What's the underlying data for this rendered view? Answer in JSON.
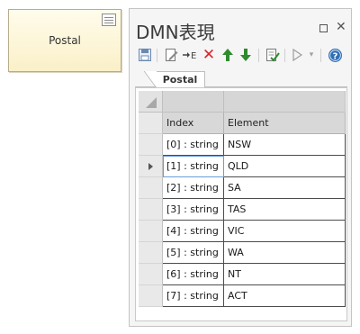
{
  "diagram": {
    "element_label": "Postal"
  },
  "window": {
    "title": "DMN表現",
    "maximize_icon": "maximize-icon",
    "close_icon": "close-icon"
  },
  "toolbar": {
    "icons": [
      "save-icon",
      "edit-icon",
      "insert-icon",
      "delete-icon",
      "move-up-icon",
      "move-down-icon",
      "validate-icon",
      "run-icon",
      "dropdown-icon",
      "help-icon"
    ],
    "colors": {
      "delete": "#d9262c",
      "arrows": "#2e8b2e",
      "help": "#2d6fb7"
    }
  },
  "tabs": [
    {
      "label": "Postal"
    }
  ],
  "table": {
    "columns": [
      "Index",
      "Element"
    ],
    "rows": [
      {
        "index": "[0] : string",
        "element": "NSW"
      },
      {
        "index": "[1] : string",
        "element": "QLD"
      },
      {
        "index": "[2] : string",
        "element": "SA"
      },
      {
        "index": "[3] : string",
        "element": "TAS"
      },
      {
        "index": "[4] : string",
        "element": "VIC"
      },
      {
        "index": "[5] : string",
        "element": "WA"
      },
      {
        "index": "[6] : string",
        "element": "NT"
      },
      {
        "index": "[7] : string",
        "element": "ACT"
      }
    ],
    "selected_row": 1
  }
}
